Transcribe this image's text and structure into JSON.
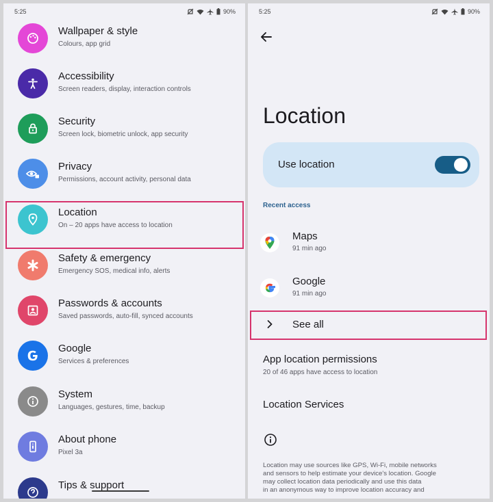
{
  "status_bar": {
    "time": "5:25",
    "battery": "90%"
  },
  "left_screen": {
    "items": [
      {
        "title": "Wallpaper & style",
        "subtitle": "Colours, app grid",
        "icon": "palette-icon",
        "color": "#e447d7"
      },
      {
        "title": "Accessibility",
        "subtitle": "Screen readers, display, interaction controls",
        "icon": "accessibility-icon",
        "color": "#4a2aa8"
      },
      {
        "title": "Security",
        "subtitle": "Screen lock, biometric unlock, app security",
        "icon": "lock-icon",
        "color": "#1e9d5a"
      },
      {
        "title": "Privacy",
        "subtitle": "Permissions, account activity, personal data",
        "icon": "eye-lock-icon",
        "color": "#4d8ee8"
      },
      {
        "title": "Location",
        "subtitle": "On – 20 apps have access to location",
        "icon": "location-pin-icon",
        "color": "#3cc4cf"
      },
      {
        "title": "Safety & emergency",
        "subtitle": "Emergency SOS, medical info, alerts",
        "icon": "asterisk-icon",
        "color": "#f07b6d"
      },
      {
        "title": "Passwords & accounts",
        "subtitle": "Saved passwords, auto-fill, synced accounts",
        "icon": "account-box-icon",
        "color": "#e0466a"
      },
      {
        "title": "Google",
        "subtitle": "Services & preferences",
        "icon": "google-g-icon",
        "color": "#1a73e8"
      },
      {
        "title": "System",
        "subtitle": "Languages, gestures, time, backup",
        "icon": "info-icon",
        "color": "#8a8a8a"
      },
      {
        "title": "About phone",
        "subtitle": "Pixel 3a",
        "icon": "phone-icon",
        "color": "#6f7ce0"
      },
      {
        "title": "Tips & support",
        "subtitle": "",
        "icon": "help-icon",
        "color": "#2c3a8c"
      }
    ]
  },
  "right_screen": {
    "title": "Location",
    "use_location": {
      "label": "Use location",
      "on": true
    },
    "recent_access_label": "Recent access",
    "recent_apps": [
      {
        "name": "Maps",
        "time": "91 min ago",
        "icon": "maps-pin-icon"
      },
      {
        "name": "Google",
        "time": "91 min ago",
        "icon": "google-logo-icon"
      }
    ],
    "see_all_label": "See all",
    "app_permissions": {
      "title": "App location permissions",
      "subtitle": "20 of 46 apps have access to location"
    },
    "location_services": {
      "title": "Location Services"
    },
    "footer_lines": [
      "Location may use sources like GPS, Wi-Fi, mobile networks",
      "and sensors to help estimate your device's location. Google",
      "may collect location data periodically and use this data",
      "in an anonymous way to improve location accuracy and"
    ]
  }
}
